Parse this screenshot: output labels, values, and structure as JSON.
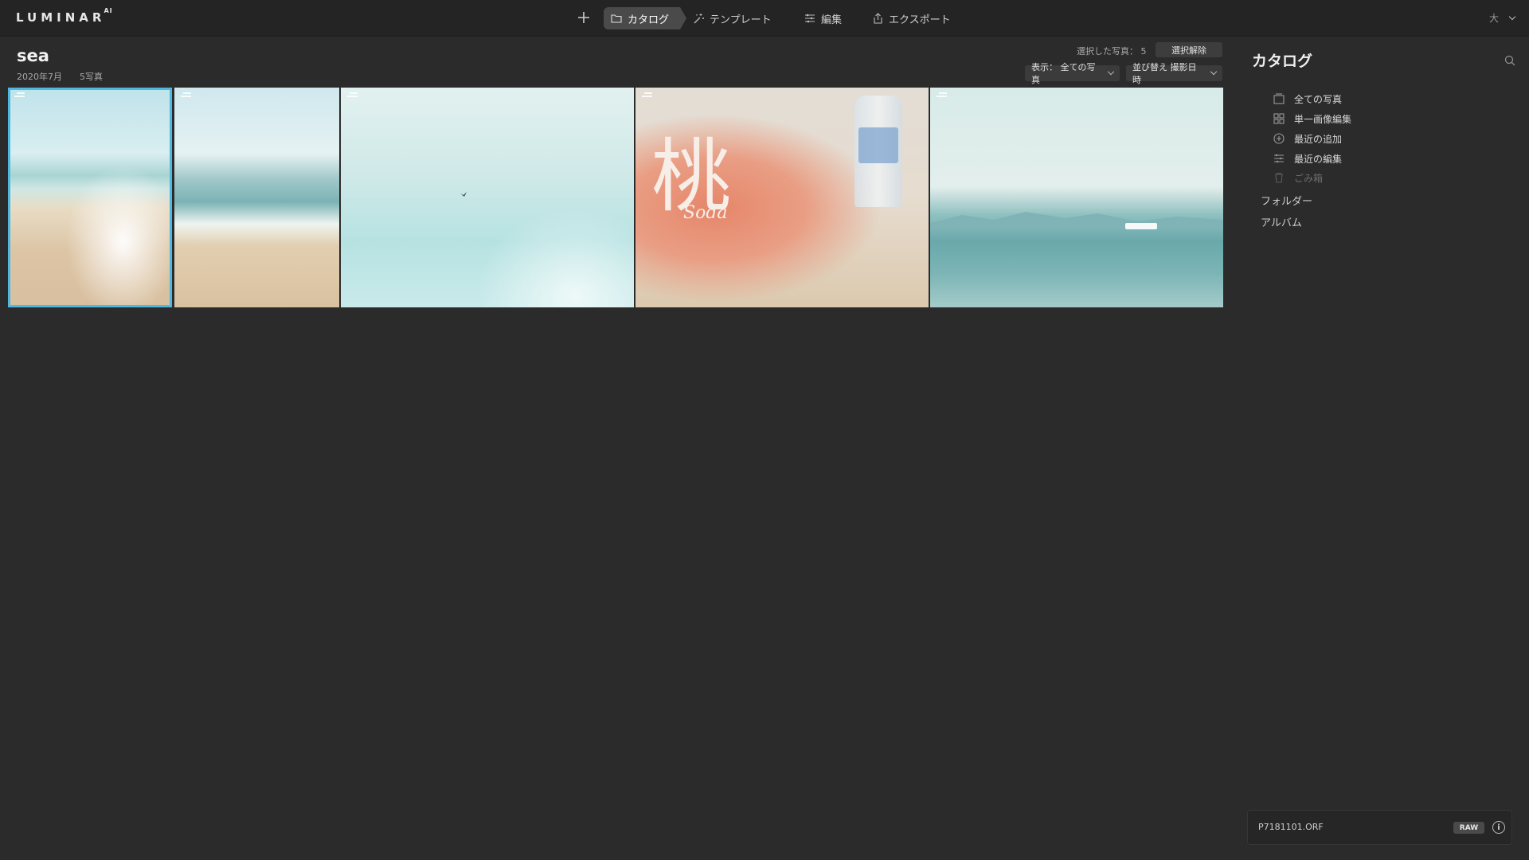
{
  "app": {
    "logo": "LUMINAR",
    "logo_suffix": "AI"
  },
  "nav": {
    "tabs": [
      {
        "label": "カタログ",
        "icon": "folder-icon",
        "active": true
      },
      {
        "label": "テンプレート",
        "icon": "magic-wand-icon"
      },
      {
        "label": "編集",
        "icon": "sliders-icon"
      },
      {
        "label": "エクスポート",
        "icon": "share-icon"
      }
    ],
    "view_size_label": "大"
  },
  "album": {
    "title": "sea",
    "date": "2020年7月",
    "count": "5写真"
  },
  "toolbar": {
    "selected_text": "選択した写真： 5",
    "deselect_label": "選択解除",
    "view_dropdown": "表示： 全ての写真",
    "sort_dropdown": "並び替え 撮影日時"
  },
  "photos": [
    {
      "name": "beach-waves-portrait",
      "selected": true
    },
    {
      "name": "waves-on-sand"
    },
    {
      "name": "sky-with-bird"
    },
    {
      "name": "peach-soda-bottle",
      "text_char": "桃",
      "text_script": "Soda"
    },
    {
      "name": "sea-with-boat"
    }
  ],
  "panel": {
    "title": "カタログ",
    "items": [
      {
        "label": "全ての写真",
        "icon": "photos-icon"
      },
      {
        "label": "単一画像編集",
        "icon": "grid-icon"
      },
      {
        "label": "最近の追加",
        "icon": "plus-circle-icon"
      },
      {
        "label": "最近の編集",
        "icon": "sliders-icon"
      },
      {
        "label": "ごみ箱",
        "icon": "trash-icon",
        "disabled": true
      }
    ],
    "folders_label": "フォルダー",
    "albums_label": "アルバム"
  },
  "file": {
    "name": "P7181101.ORF",
    "badge": "RAW",
    "info": "i"
  },
  "colors": {
    "selection": "#4fb8e0",
    "background": "#2b2b2b",
    "topbar": "#242424"
  }
}
